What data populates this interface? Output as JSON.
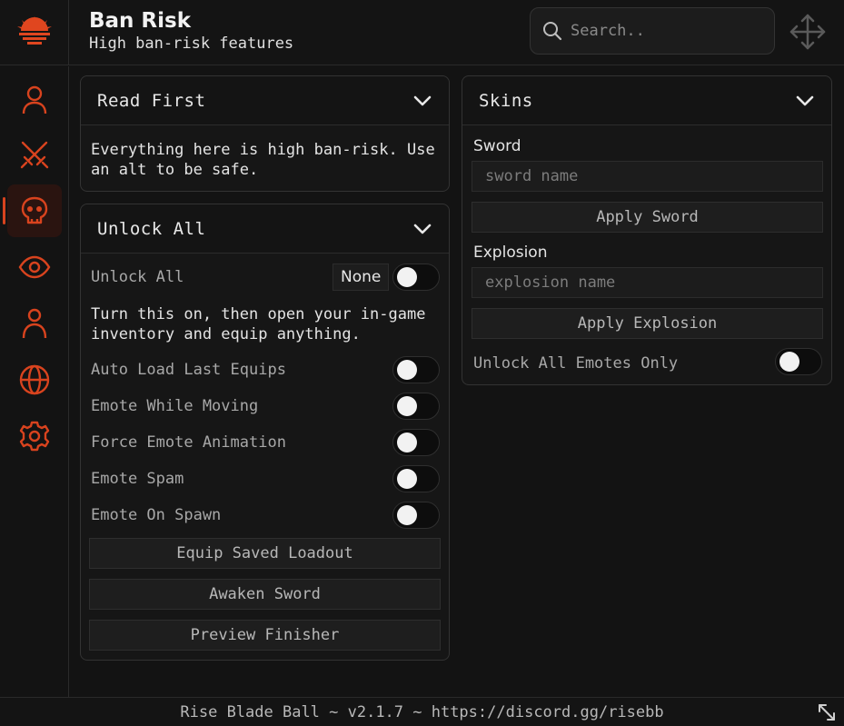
{
  "header": {
    "title": "Ban Risk",
    "subtitle": "High ban-risk features",
    "search_placeholder": "Search.."
  },
  "sidebar": {
    "items": [
      {
        "icon": "user-icon",
        "active": false
      },
      {
        "icon": "swords-icon",
        "active": false
      },
      {
        "icon": "skull-icon",
        "active": true
      },
      {
        "icon": "eye-icon",
        "active": false
      },
      {
        "icon": "person-icon",
        "active": false
      },
      {
        "icon": "globe-icon",
        "active": false
      },
      {
        "icon": "gear-icon",
        "active": false
      }
    ]
  },
  "read_first": {
    "title": "Read First",
    "text_line1": "Everything here is high ban-risk. Use",
    "text_line2": "an alt to be safe."
  },
  "unlock_all": {
    "title": "Unlock All",
    "toggle_label": "Unlock All",
    "keybind": "None",
    "note_line1": "Turn this on, then open your in-game",
    "note_line2": "inventory and equip anything.",
    "toggles": [
      {
        "label": "Auto Load Last Equips",
        "on": false
      },
      {
        "label": "Emote While Moving",
        "on": false
      },
      {
        "label": "Force Emote Animation",
        "on": false
      },
      {
        "label": "Emote Spam",
        "on": false
      },
      {
        "label": "Emote On Spawn",
        "on": false
      }
    ],
    "buttons": [
      "Equip Saved Loadout",
      "Awaken Sword",
      "Preview Finisher"
    ]
  },
  "skins": {
    "title": "Skins",
    "sword_label": "Sword",
    "sword_placeholder": "sword name",
    "apply_sword": "Apply Sword",
    "explosion_label": "Explosion",
    "explosion_placeholder": "explosion name",
    "apply_explosion": "Apply Explosion",
    "emotes_toggle_label": "Unlock All Emotes Only",
    "emotes_toggle_on": false
  },
  "footer": {
    "text": "Rise Blade Ball ~ v2.1.7 ~ https://discord.gg/risebb"
  },
  "colors": {
    "accent": "#d8431e",
    "background": "#131313",
    "panel": "#161616"
  }
}
